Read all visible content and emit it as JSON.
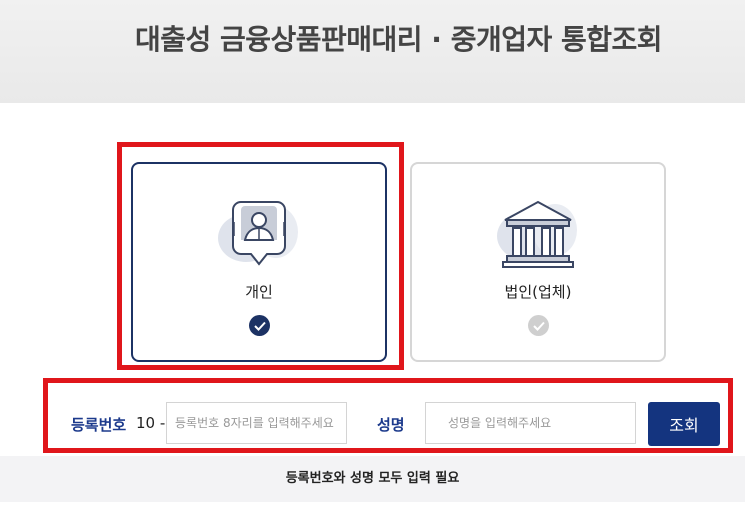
{
  "header": {
    "title": "대출성 금융상품판매대리 · 중개업자 통합조회"
  },
  "cards": {
    "personal": {
      "label": "개인",
      "selected": true
    },
    "corporate": {
      "label": "법인(업체)",
      "selected": false
    }
  },
  "form": {
    "reg_label": "등록번호",
    "reg_prefix": "10 -",
    "reg_placeholder": "등록번호 8자리를 입력해주세요",
    "name_label": "성명",
    "name_placeholder": "성명을 입력해주세요",
    "search_button": "조회"
  },
  "notice": "등록번호와 성명 모두 입력 필요",
  "colors": {
    "accent": "#14347f",
    "highlight": "#e0161b",
    "label": "#1c3a8c"
  }
}
